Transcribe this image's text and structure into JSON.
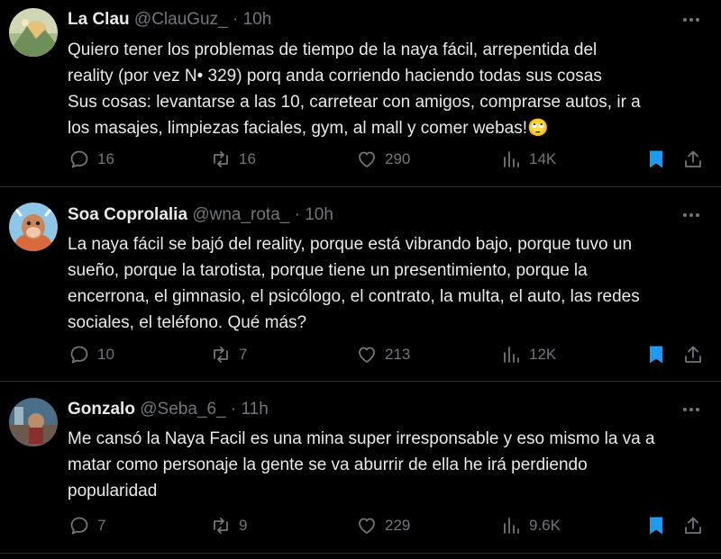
{
  "tweets": [
    {
      "name": "La Clau",
      "handle": "@ClauGuz_",
      "dot": "·",
      "time": "10h",
      "lines": [
        "Quiero tener los problemas de tiempo de la naya fácil, arrepentida del",
        "reality (por vez N• 329) porq anda corriendo haciendo todas sus cosas",
        "Sus cosas: levantarse a las 10, carretear con amigos, comprarse autos, ir a",
        "los masajes, limpiezas faciales, gym, al mall y comer webas!🙄"
      ],
      "replies": "16",
      "retweets": "16",
      "likes": "290",
      "views": "14K",
      "bookmarked": true,
      "avatar_icon": "landscape-avatar-icon"
    },
    {
      "name": "Soa Coprolalia",
      "handle": "@wna_rota_",
      "dot": "·",
      "time": "10h",
      "lines": [
        "La naya fácil se bajó del reality, porque está vibrando bajo, porque tuvo un",
        "sueño, porque la tarotista, porque tiene un presentimiento, porque la",
        "encerrona, el gimnasio, el psicólogo, el contrato, la multa, el auto, las redes",
        "sociales, el teléfono. Qué más?"
      ],
      "replies": "10",
      "retweets": "7",
      "likes": "213",
      "views": "12K",
      "bookmarked": true,
      "avatar_icon": "cow-avatar-icon"
    },
    {
      "name": "Gonzalo",
      "handle": "@Seba_6_",
      "dot": "·",
      "time": "11h",
      "lines": [
        "Me cansó la Naya Facil es una mina super irresponsable y eso mismo la va a",
        "matar como personaje la gente se va aburrir de ella he irá perdiendo",
        "popularidad"
      ],
      "replies": "7",
      "retweets": "9",
      "likes": "229",
      "views": "9.6K",
      "bookmarked": true,
      "avatar_icon": "photo-avatar-icon"
    }
  ],
  "colors": {
    "background": "#000000",
    "text": "#e7e9ea",
    "muted": "#71767b",
    "divider": "#2f3336",
    "bookmark": "#1d9bf0"
  }
}
